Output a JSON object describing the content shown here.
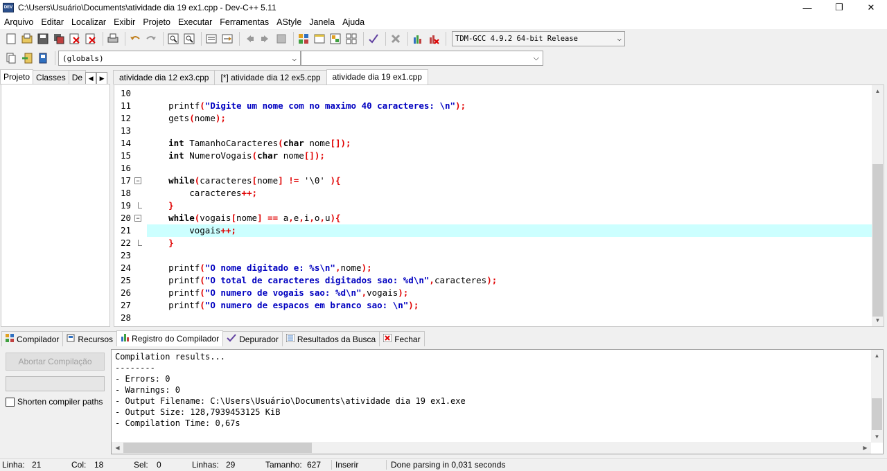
{
  "window": {
    "title": "C:\\Users\\Usuário\\Documents\\atividade dia 19 ex1.cpp - Dev-C++ 5.11",
    "app_icon_text": "DEV",
    "controls": [
      "minimize-icon",
      "maximize-icon",
      "close-icon"
    ]
  },
  "menu": [
    "Arquivo",
    "Editar",
    "Localizar",
    "Exibir",
    "Projeto",
    "Executar",
    "Ferramentas",
    "AStyle",
    "Janela",
    "Ajuda"
  ],
  "toolbar": {
    "compiler": "TDM-GCC 4.9.2 64-bit Release",
    "scope": "(globals)",
    "member": ""
  },
  "left_tabs": [
    "Projeto",
    "Classes",
    "De"
  ],
  "file_tabs": [
    "atividade dia 12 ex3.cpp",
    "[*] atividade dia 12 ex5.cpp",
    "atividade dia 19 ex1.cpp"
  ],
  "code": {
    "lines": [
      {
        "n": "10",
        "text": ""
      },
      {
        "n": "11",
        "text": "    printf(\"Digite um nome com no maximo 40 caracteres: \\n\");"
      },
      {
        "n": "12",
        "text": "    gets(nome);"
      },
      {
        "n": "13",
        "text": ""
      },
      {
        "n": "14",
        "text": "    int TamanhoCaracteres(char nome[]);"
      },
      {
        "n": "15",
        "text": "    int NumeroVogais(char nome[]);"
      },
      {
        "n": "16",
        "text": ""
      },
      {
        "n": "17",
        "text": "    while(caracteres[nome] != '\\0' ){"
      },
      {
        "n": "18",
        "text": "        caracteres++;"
      },
      {
        "n": "19",
        "text": "    }"
      },
      {
        "n": "20",
        "text": "    while(vogais[nome] == a,e,i,o,u){"
      },
      {
        "n": "21",
        "text": "        vogais++;"
      },
      {
        "n": "22",
        "text": "    }"
      },
      {
        "n": "23",
        "text": ""
      },
      {
        "n": "24",
        "text": "    printf(\"O nome digitado e: %s\\n\",nome);"
      },
      {
        "n": "25",
        "text": "    printf(\"O total de caracteres digitados sao: %d\\n\",caracteres);"
      },
      {
        "n": "26",
        "text": "    printf(\"O numero de vogais sao: %d\\n\",vogais);"
      },
      {
        "n": "27",
        "text": "    printf(\"O numero de espacos em branco sao: \\n\");"
      },
      {
        "n": "28",
        "text": ""
      }
    ],
    "highlighted_line": "21"
  },
  "bottom_tabs": [
    {
      "label": "Compilador",
      "icon": "grid-icon"
    },
    {
      "label": "Recursos",
      "icon": "resources-icon"
    },
    {
      "label": "Registro do Compilador",
      "icon": "chart-icon"
    },
    {
      "label": "Depurador",
      "icon": "check-icon"
    },
    {
      "label": "Resultados da Busca",
      "icon": "search-results-icon"
    },
    {
      "label": "Fechar",
      "icon": "close-panel-icon"
    }
  ],
  "compiler_panel": {
    "abort_label": "Abortar Compilação",
    "shorten_label": "Shorten compiler paths",
    "shorten_checked": false
  },
  "log": [
    "Compilation results...",
    "--------",
    "- Errors: 0",
    "- Warnings: 0",
    "- Output Filename: C:\\Users\\Usuário\\Documents\\atividade dia 19 ex1.exe",
    "- Output Size: 128,7939453125 KiB",
    "- Compilation Time: 0,67s"
  ],
  "status": {
    "linha_label": "Linha:",
    "linha": "21",
    "col_label": "Col:",
    "col": "18",
    "sel_label": "Sel:",
    "sel": "0",
    "linhas_label": "Linhas:",
    "linhas": "29",
    "tamanho_label": "Tamanho:",
    "tamanho": "627",
    "mode": "Inserir",
    "message": "Done parsing in 0,031 seconds"
  }
}
